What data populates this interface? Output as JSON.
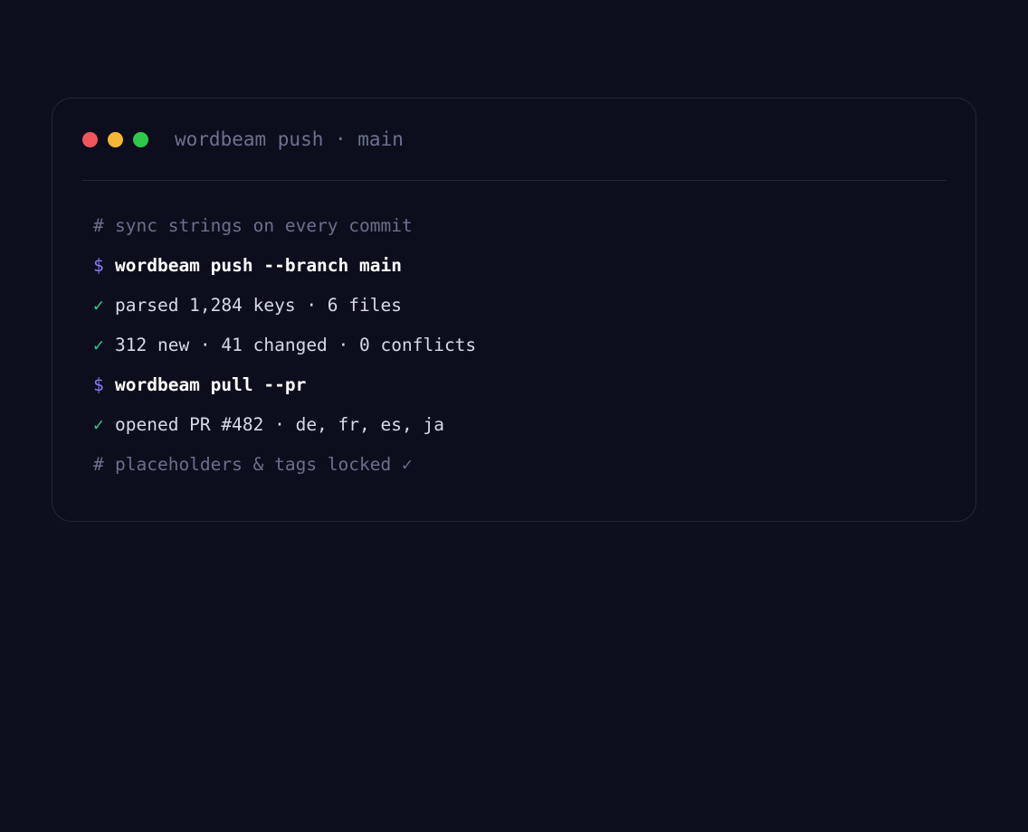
{
  "window": {
    "title": "wordbeam push · main",
    "controls": {
      "close_color": "#f2545b",
      "minimize_color": "#f4b731",
      "maximize_color": "#2ec84b"
    }
  },
  "lines": [
    {
      "kind": "comment",
      "mark": "#",
      "text": "sync strings on every commit"
    },
    {
      "kind": "prompt",
      "mark": "$",
      "text": "wordbeam push --branch main"
    },
    {
      "kind": "ok",
      "mark": "✓",
      "text": "parsed 1,284 keys · 6 files"
    },
    {
      "kind": "ok",
      "mark": "✓",
      "text": "312 new · 41 changed · 0 conflicts"
    },
    {
      "kind": "prompt",
      "mark": "$",
      "text": "wordbeam pull --pr"
    },
    {
      "kind": "ok",
      "mark": "✓",
      "text": "opened PR #482 · de, fr, es, ja"
    },
    {
      "kind": "comment",
      "mark": "#",
      "text": "placeholders & tags locked ✓"
    }
  ],
  "colors": {
    "background": "#0e0f1e",
    "prompt_accent": "#8b7cf6",
    "success_accent": "#35c98a",
    "comment": "#6b6f8c"
  }
}
